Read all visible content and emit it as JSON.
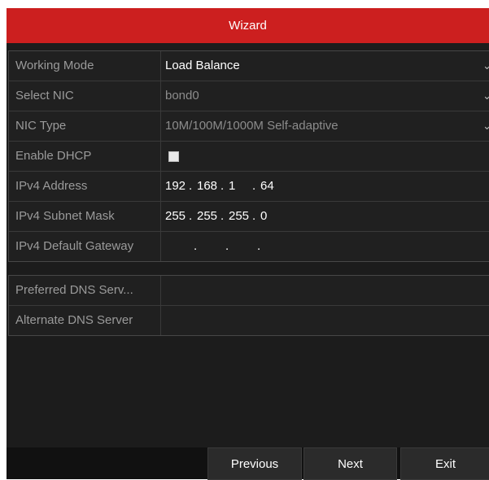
{
  "window": {
    "title": "Wizard"
  },
  "network": {
    "working_mode": {
      "label": "Working Mode",
      "value": "Load Balance"
    },
    "select_nic": {
      "label": "Select NIC",
      "value": "bond0"
    },
    "nic_type": {
      "label": "NIC Type",
      "value": "10M/100M/1000M Self-adaptive"
    },
    "enable_dhcp": {
      "label": "Enable DHCP",
      "checked": false
    },
    "ipv4_address": {
      "label": "IPv4 Address",
      "octets": [
        "192",
        "168",
        "1",
        "64"
      ]
    },
    "ipv4_subnet_mask": {
      "label": "IPv4 Subnet Mask",
      "octets": [
        "255",
        "255",
        "255",
        "0"
      ]
    },
    "ipv4_default_gateway": {
      "label": "IPv4 Default Gateway",
      "octets": [
        "",
        "",
        "",
        ""
      ]
    }
  },
  "dns": {
    "preferred": {
      "label": "Preferred DNS Serv...",
      "value": ""
    },
    "alternate": {
      "label": "Alternate DNS Server",
      "value": ""
    }
  },
  "buttons": {
    "previous": "Previous",
    "next": "Next",
    "exit": "Exit"
  },
  "colors": {
    "title_bar": "#cc1f1f",
    "background": "#1c1c1c",
    "field_text": "#ffffff",
    "label_text": "#9a9a9a"
  },
  "icons": {
    "dropdown": "chevron-down-icon",
    "checkbox": "checkbox-unchecked"
  }
}
